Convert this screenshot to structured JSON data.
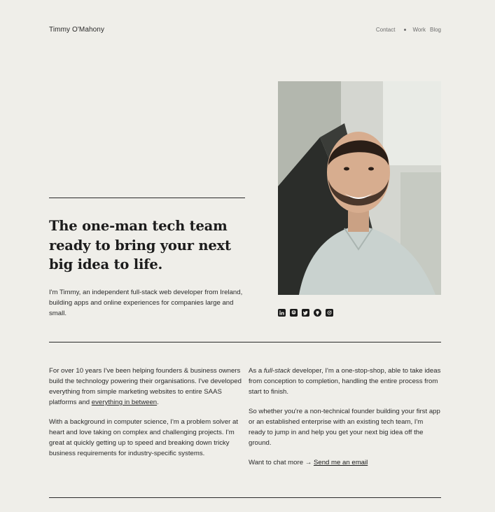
{
  "header": {
    "site_name": "Timmy O'Mahony",
    "nav": {
      "contact": "Contact",
      "work": "Work",
      "blog": "Blog"
    }
  },
  "hero": {
    "headline": "The one-man tech team ready to bring your next big idea to life.",
    "intro": "I'm Timmy, an independent full-stack web developer from Ireland, building apps and online experiences for companies large and small."
  },
  "socials": [
    "linkedin-icon",
    "mastodon-icon",
    "twitter-icon",
    "github-icon",
    "dribbble-icon"
  ],
  "about": {
    "left_p1_a": "For over 10 years I've been helping founders & business owners build the technology powering their organisations. I've developed everything from simple marketing websites to entire SAAS platforms and ",
    "left_p1_link": "everything in between",
    "left_p1_b": ".",
    "left_p2": "With a background in computer science, I'm a problem solver at heart and love taking on complex and challenging projects. I'm great at quickly getting up to speed and breaking down tricky business requirements for industry-specific systems.",
    "right_p1_a": "As a ",
    "right_p1_em": "full-stack",
    "right_p1_b": " developer, I'm a one-stop-shop, able to take ideas from conception to completion, handling the entire process from start to finish.",
    "right_p2": "So whether you're a non-technical founder building your first app or an established enterprise with an existing tech team, I'm ready to jump in and help you get your next big idea off the ground.",
    "chat_prefix": "Want to chat more → ",
    "chat_link": "Send me an email"
  }
}
